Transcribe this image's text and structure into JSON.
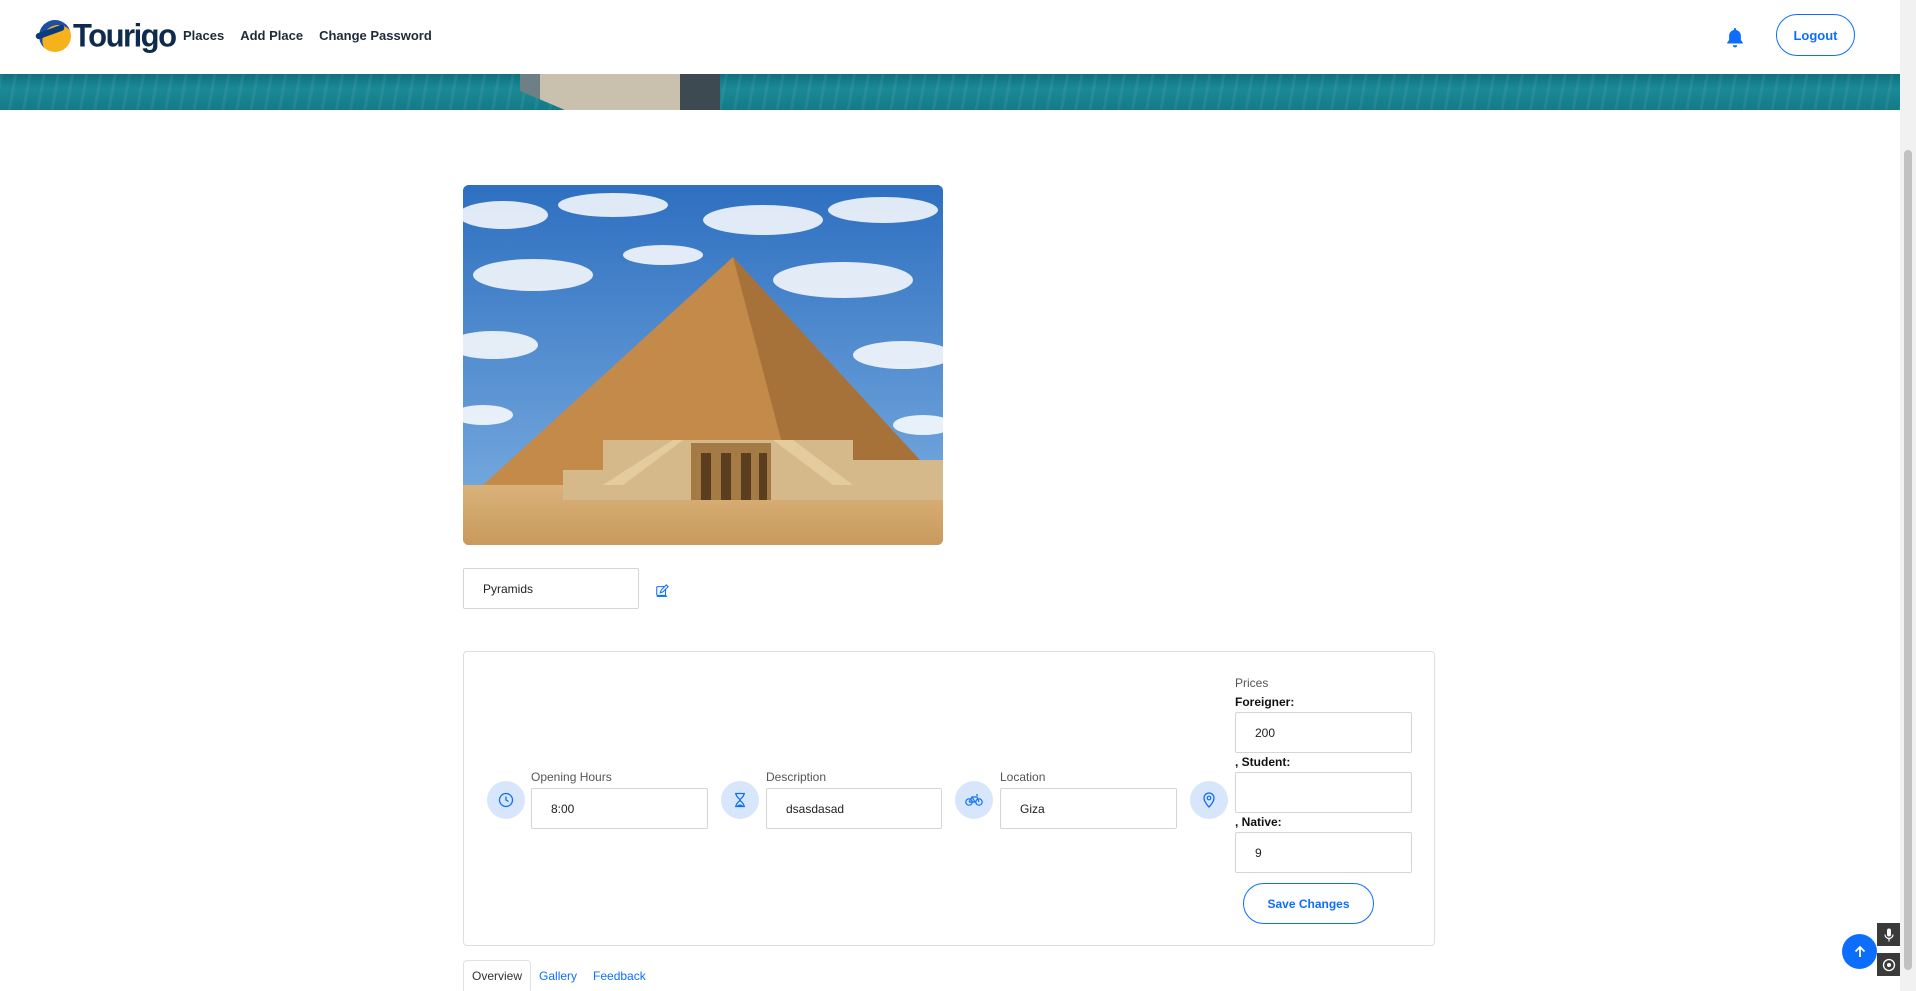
{
  "header": {
    "brand": "Tourigo",
    "nav": [
      "Places",
      "Add Place",
      "Change Password"
    ],
    "logout_label": "Logout"
  },
  "place": {
    "name": "Pyramids"
  },
  "details": {
    "opening_hours": {
      "label": "Opening Hours",
      "value": "8:00"
    },
    "description": {
      "label": "Description",
      "value": "dsasdasad"
    },
    "location": {
      "label": "Location",
      "value": "Giza"
    },
    "prices": {
      "title": "Prices",
      "foreigner_label": "Foreigner:",
      "foreigner_value": "200",
      "student_label": ", Student:",
      "student_value": "",
      "native_label": ", Native:",
      "native_value": "9"
    },
    "save_label": "Save Changes"
  },
  "tabs": [
    {
      "label": "Overview",
      "active": true
    },
    {
      "label": "Gallery",
      "active": false
    },
    {
      "label": "Feedback",
      "active": false
    }
  ],
  "colors": {
    "accent": "#0d6efd",
    "icon_bg": "#d8e6fb",
    "brand_dark": "#0e2a4d"
  }
}
